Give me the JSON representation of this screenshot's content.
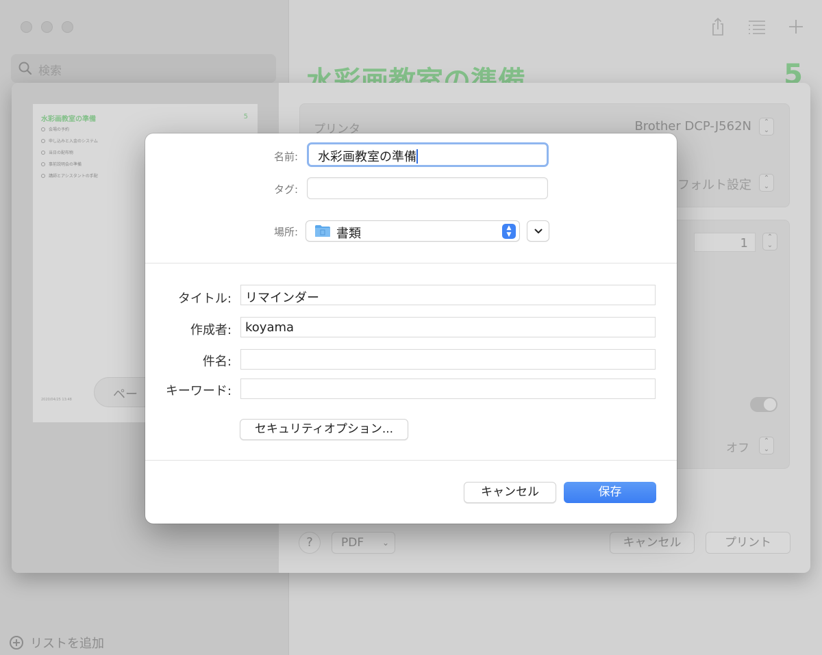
{
  "sidebar": {
    "search_placeholder": "検索",
    "add_list_label": "リストを追加"
  },
  "list": {
    "title": "水彩画教室の準備",
    "count": "5"
  },
  "print_dialog": {
    "preview": {
      "title": "水彩画教室の準備",
      "count": "5",
      "items": [
        "会場の予約",
        "申し込みと入金のシステム",
        "当日の配布物",
        "事前説明会の準備",
        "講師とアシスタントの手配"
      ],
      "footer": "2020/04/25 13:48",
      "page_button_label": "ペー"
    },
    "printer_label": "プリンタ",
    "printer_value": "Brother DCP-J562N",
    "preset_value": "フォルト設定",
    "copies_value": "1",
    "off_value": "オフ",
    "help_label": "?",
    "pdf_label": "PDF",
    "cancel_label": "キャンセル",
    "print_label": "プリント"
  },
  "save_dialog": {
    "name_label": "名前:",
    "name_value": "水彩画教室の準備",
    "tags_label": "タグ:",
    "location_label": "場所:",
    "location_value": "書類",
    "fields": [
      {
        "label": "タイトル:",
        "value": "リマインダー"
      },
      {
        "label": "作成者:",
        "value": "koyama"
      },
      {
        "label": "件名:",
        "value": ""
      },
      {
        "label": "キーワード:",
        "value": ""
      }
    ],
    "security_button": "セキュリティオプション...",
    "cancel_button": "キャンセル",
    "save_button": "保存"
  }
}
